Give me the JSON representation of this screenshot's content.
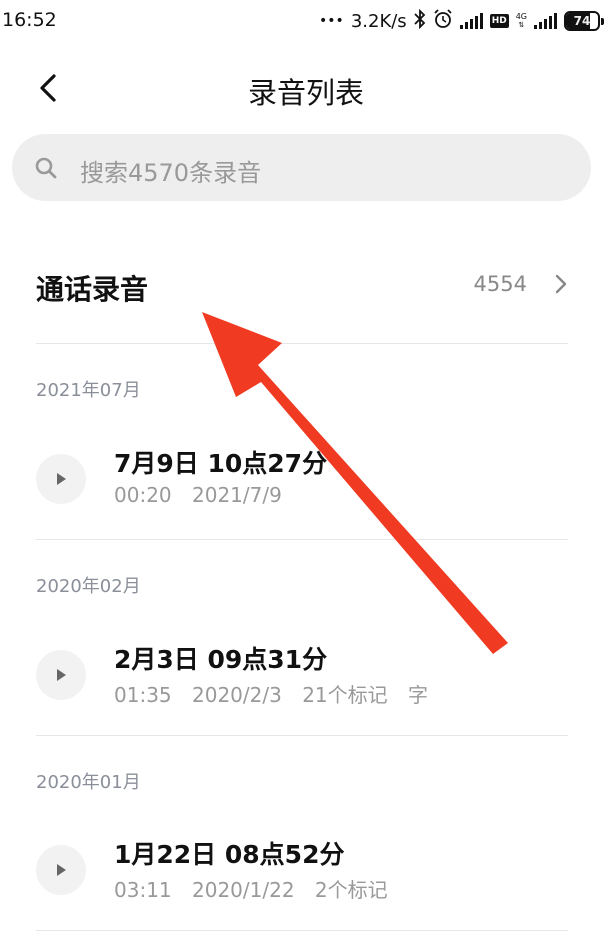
{
  "status_bar": {
    "time": "16:52",
    "dots": "•••",
    "speed": "3.2K/s",
    "hd": "HD",
    "network": "4G",
    "battery": "74",
    "battery_level_percent": 74
  },
  "header": {
    "title": "录音列表"
  },
  "search": {
    "placeholder": "搜索4570条录音"
  },
  "call_recordings": {
    "label": "通话录音",
    "count": "4554"
  },
  "groups": [
    {
      "month": "2021年07月",
      "items": [
        {
          "title": "7月9日 10点27分",
          "duration": "00:20",
          "date": "2021/7/9",
          "marks": "",
          "extra": ""
        }
      ]
    },
    {
      "month": "2020年02月",
      "items": [
        {
          "title": "2月3日 09点31分",
          "duration": "01:35",
          "date": "2020/2/3",
          "marks": "21个标记",
          "extra": "字"
        }
      ]
    },
    {
      "month": "2020年01月",
      "items": [
        {
          "title": "1月22日 08点52分",
          "duration": "03:11",
          "date": "2020/1/22",
          "marks": "2个标记",
          "extra": ""
        }
      ]
    }
  ],
  "colors": {
    "annotation_arrow": "#f03a22",
    "accent_text": "#111111",
    "muted_text": "#999999"
  }
}
